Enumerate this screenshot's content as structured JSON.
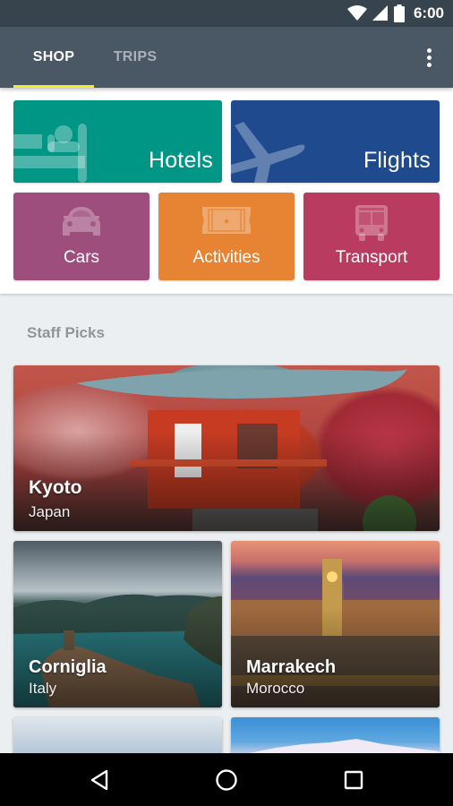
{
  "status_bar": {
    "time": "6:00",
    "icons": [
      "wifi-icon",
      "cellular-signal-icon",
      "battery-icon"
    ]
  },
  "app_bar": {
    "tabs": [
      {
        "label": "SHOP",
        "selected": true
      },
      {
        "label": "TRIPS",
        "selected": false
      }
    ],
    "overflow_icon": "more-vert-icon",
    "indicator_color": "#f3ea2a"
  },
  "shop": {
    "tiles": [
      {
        "label": "Hotels",
        "icon": "bed-icon",
        "color": "#009686"
      },
      {
        "label": "Flights",
        "icon": "airplane-icon",
        "color": "#1f4a8e"
      },
      {
        "label": "Cars",
        "icon": "car-icon",
        "color": "#9d4e7c"
      },
      {
        "label": "Activities",
        "icon": "ticket-icon",
        "color": "#e78433"
      },
      {
        "label": "Transport",
        "icon": "bus-icon",
        "color": "#b93b5f"
      }
    ]
  },
  "staff_picks": {
    "title": "Staff Picks",
    "cards": [
      {
        "city": "Kyoto",
        "country": "Japan"
      },
      {
        "city": "Corniglia",
        "country": "Italy"
      },
      {
        "city": "Marrakech",
        "country": "Morocco"
      }
    ]
  },
  "nav_bar": {
    "buttons": [
      "back-icon",
      "home-icon",
      "recents-icon"
    ]
  }
}
